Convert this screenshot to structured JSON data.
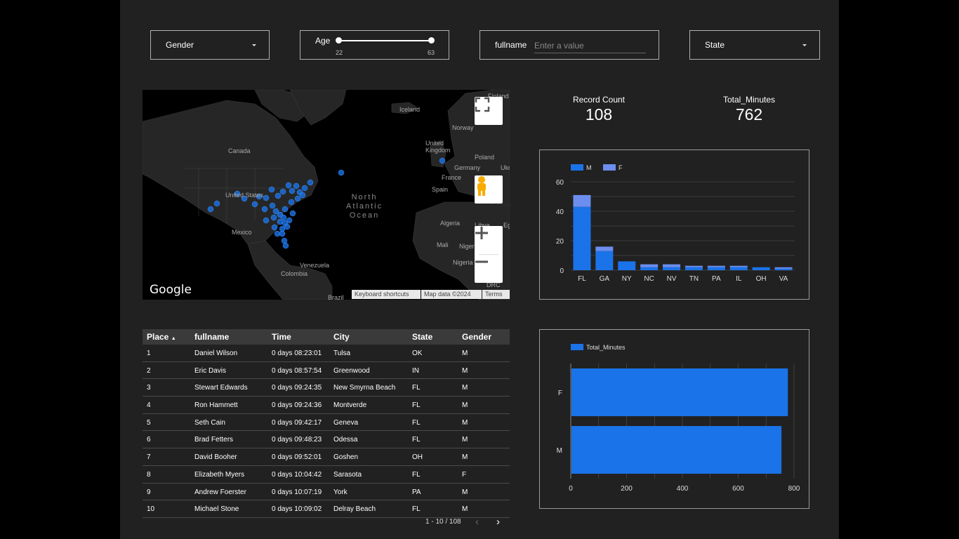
{
  "filters": {
    "gender_label": "Gender",
    "age_label": "Age",
    "age_min": "22",
    "age_max": "63",
    "fullname_label": "fullname",
    "fullname_placeholder": "Enter a value",
    "fullname_value": "",
    "state_label": "State"
  },
  "map": {
    "labels": {
      "iceland": "Iceland",
      "finland": "Finland",
      "norway": "Norway",
      "uk": "United Kingdom",
      "poland": "Poland",
      "germany": "Germany",
      "ukraine": "Ukr",
      "france": "France",
      "spain": "Spain",
      "canada": "Canada",
      "us": "United States",
      "mexico": "Mexico",
      "algeria": "Algeria",
      "libya": "Libya",
      "egypt": "Egypt",
      "mali": "Mali",
      "niger": "Niger",
      "nigeria": "Nigeria",
      "venezuela": "Venezuela",
      "colombia": "Colombia",
      "brazil": "Brazil",
      "drc": "DRC"
    },
    "ocean_line1": "North",
    "ocean_line2": "Atlantic",
    "ocean_line3": "Ocean",
    "google_logo": "Google",
    "keyboard_shortcuts": "Keyboard shortcuts",
    "map_data": "Map data ©2024",
    "terms": "Terms"
  },
  "kpis": {
    "record_count_label": "Record Count",
    "record_count_value": "108",
    "total_minutes_label": "Total_Minutes",
    "total_minutes_value": "762"
  },
  "colors": {
    "male": "#1a73e8",
    "female": "#6c8eef"
  },
  "chart_data": [
    {
      "type": "bar",
      "stacked": true,
      "categories": [
        "FL",
        "GA",
        "NY",
        "NC",
        "NV",
        "TN",
        "PA",
        "IL",
        "OH",
        "VA"
      ],
      "series": [
        {
          "name": "M",
          "values": [
            43,
            13,
            6,
            2,
            2,
            2,
            2,
            2,
            2,
            1
          ]
        },
        {
          "name": "F",
          "values": [
            8,
            3,
            0,
            2,
            2,
            1,
            1,
            1,
            0,
            1
          ]
        }
      ],
      "ylim": [
        0,
        60
      ],
      "yticks": [
        "0",
        "20",
        "40",
        "60"
      ],
      "legend": "top-left",
      "grid": true
    },
    {
      "type": "bar",
      "orientation": "horizontal",
      "categories": [
        "F",
        "M"
      ],
      "series": [
        {
          "name": "Total_Minutes",
          "values": [
            778,
            755
          ]
        }
      ],
      "xlim": [
        0,
        800
      ],
      "xticks": [
        "0",
        "200",
        "400",
        "600",
        "800"
      ],
      "legend": "top-left",
      "grid": true
    }
  ],
  "table": {
    "headers": [
      "Place",
      "fullname",
      "Time",
      "City",
      "State",
      "Gender"
    ],
    "rows": [
      [
        "1",
        "Daniel Wilson",
        "0 days 08:23:01",
        "Tulsa",
        "OK",
        "M"
      ],
      [
        "2",
        "Eric Davis",
        "0 days 08:57:54",
        "Greenwood",
        "IN",
        "M"
      ],
      [
        "3",
        "Stewart Edwards",
        "0 days 09:24:35",
        "New Smyrna Beach",
        "FL",
        "M"
      ],
      [
        "4",
        "Ron Hammett",
        "0 days 09:24:36",
        "Montverde",
        "FL",
        "M"
      ],
      [
        "5",
        "Seth Cain",
        "0 days 09:42:17",
        "Geneva",
        "FL",
        "M"
      ],
      [
        "6",
        "Brad Fetters",
        "0 days 09:48:23",
        "Odessa",
        "FL",
        "M"
      ],
      [
        "7",
        "David Booher",
        "0 days 09:52:01",
        "Goshen",
        "OH",
        "M"
      ],
      [
        "8",
        "Elizabeth Myers",
        "0 days 10:04:42",
        "Sarasota",
        "FL",
        "F"
      ],
      [
        "9",
        "Andrew Foerster",
        "0 days 10:07:19",
        "York",
        "PA",
        "M"
      ],
      [
        "10",
        "Michael Stone",
        "0 days 10:09:02",
        "Delray Beach",
        "FL",
        "M"
      ]
    ],
    "pagination": "1 - 10 / 108"
  }
}
